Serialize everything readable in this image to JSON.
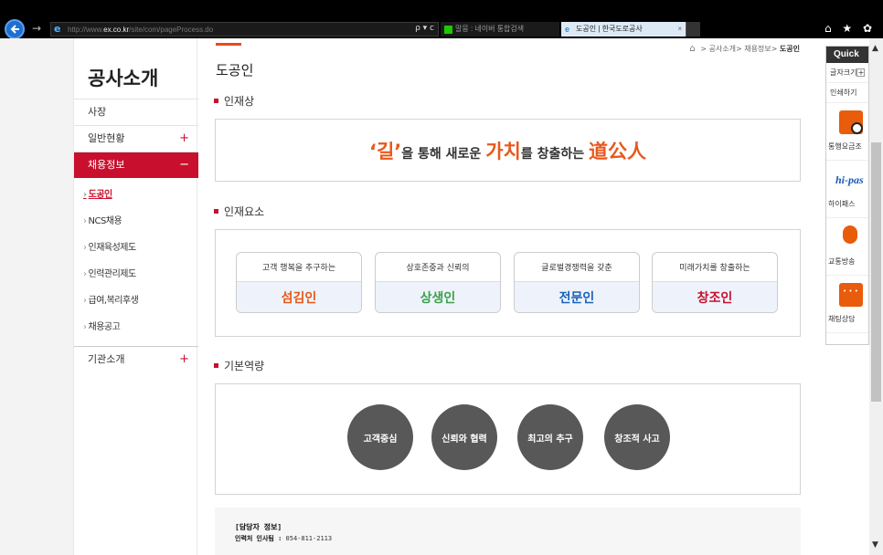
{
  "browser": {
    "url_prefix": "http://www.",
    "url_domain": "ex.co.kr",
    "url_suffix": "/site/com/pageProcess.do",
    "url_controls": "ρ ▾ c",
    "tab1_label": "말뭉 : 네이버 통합검색",
    "tab2_label": "도공인 | 한국도로공사",
    "tab2_close": "×",
    "toolbar_icons": "⌂ ★ ✿"
  },
  "sidebar": {
    "title": "공사소개",
    "menu": [
      {
        "label": "사장",
        "pm": ""
      },
      {
        "label": "일반현황",
        "pm": "+"
      },
      {
        "label": "채용정보",
        "pm": "−"
      }
    ],
    "submenu": [
      {
        "label": "도공인"
      },
      {
        "label": "NCS채용"
      },
      {
        "label": "인재육성제도"
      },
      {
        "label": "인력관리제도"
      },
      {
        "label": "급여,복리후생"
      },
      {
        "label": "채용공고"
      }
    ],
    "last_menu": {
      "label": "기관소개",
      "pm": "+"
    }
  },
  "breadcrumb": {
    "items": [
      "공사소개",
      "채용정보"
    ],
    "current": "도공인"
  },
  "page_title": "도공인",
  "section1": {
    "title": "인재상",
    "slogan_q1": "‘길’",
    "slogan_a": "을 통해 새로운 ",
    "slogan_q2": "가치",
    "slogan_b": "를 창출하는 ",
    "slogan_q3": "道公人"
  },
  "section2": {
    "title": "인재요소",
    "cards": [
      {
        "desc": "고객 행복을 추구하는",
        "name": "섬김인",
        "color": "#e8581c"
      },
      {
        "desc": "상호존중과 신뢰의",
        "name": "상생인",
        "color": "#3aa14a"
      },
      {
        "desc": "글로벌경쟁력을 갖춘",
        "name": "전문인",
        "color": "#1a63b8"
      },
      {
        "desc": "미래가치를 창출하는",
        "name": "창조인",
        "color": "#c8102e"
      }
    ]
  },
  "section3": {
    "title": "기본역량",
    "items": [
      "고객중심",
      "신뢰와 협력",
      "최고의 추구",
      "창조적 사고"
    ]
  },
  "contact": {
    "title": "[담당자 정보]",
    "label": "인력처 인사팀 :",
    "phone": "054-811-2113"
  },
  "quick": {
    "header": "Quick",
    "font_size_label": "글자크기",
    "font_size_btn": "+",
    "print_label": "인쇄하기",
    "items": [
      {
        "label": "통행요금조",
        "icon": "calculator-icon"
      },
      {
        "label": "하이패스",
        "icon": "hipass-logo",
        "logo_text": "hi-pas"
      },
      {
        "label": "교통방송",
        "icon": "microphone-icon"
      },
      {
        "label": "채팅상담",
        "icon": "chat-icon"
      }
    ]
  }
}
